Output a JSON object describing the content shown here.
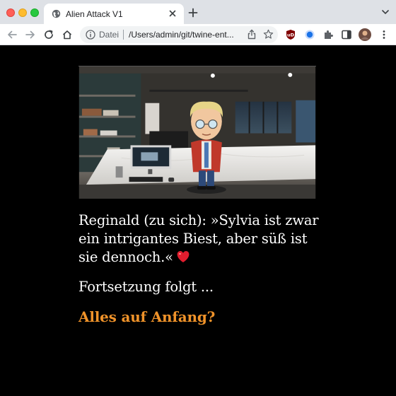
{
  "browser": {
    "tab_title": "Alien Attack V1",
    "omnibox_label": "Datei",
    "url": "/Users/admin/git/twine-ent...",
    "accent_color": "#1a73e8"
  },
  "story": {
    "line1": "Reginald (zu sich): »Sylvia ist zwar ein intrigantes Biest, aber süß ist sie dennoch.«",
    "line2": "Fortsetzung folgt ...",
    "restart_link": "Alles auf Anfang?",
    "link_color": "#f0932a",
    "heart_icon": "heart-emoji"
  }
}
